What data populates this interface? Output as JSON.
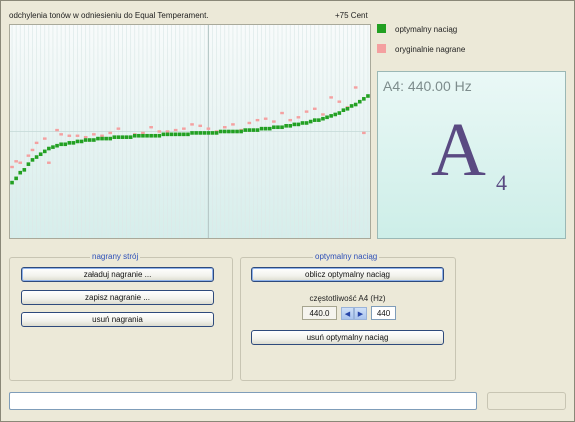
{
  "chart": {
    "title": "odchylenia tonów  w  odniesieniu do Equal Temperament.",
    "range_label": "+75 Cent",
    "legend": [
      {
        "label": "optymalny naciąg",
        "color": "#22a022"
      },
      {
        "label": "oryginalnie nagrane",
        "color": "#f4a0a0"
      }
    ]
  },
  "chart_data": {
    "type": "scatter",
    "title": "odchylenia tonów  w  odniesieniu do Equal Temperament.",
    "xlabel": "",
    "ylabel": "",
    "ylim": [
      -75,
      75
    ],
    "grid": true,
    "series": [
      {
        "name": "optymalny naciąg",
        "color": "#22a022",
        "x": [
          1,
          2,
          3,
          4,
          5,
          6,
          7,
          8,
          9,
          10,
          11,
          12,
          13,
          14,
          15,
          16,
          17,
          18,
          19,
          20,
          21,
          22,
          23,
          24,
          25,
          26,
          27,
          28,
          29,
          30,
          31,
          32,
          33,
          34,
          35,
          36,
          37,
          38,
          39,
          40,
          41,
          42,
          43,
          44,
          45,
          46,
          47,
          48,
          49,
          50,
          51,
          52,
          53,
          54,
          55,
          56,
          57,
          58,
          59,
          60,
          61,
          62,
          63,
          64,
          65,
          66,
          67,
          68,
          69,
          70,
          71,
          72,
          73,
          74,
          75,
          76,
          77,
          78,
          79,
          80,
          81,
          82,
          83,
          84,
          85,
          86,
          87,
          88
        ],
        "y": [
          -36,
          -33,
          -29,
          -27,
          -23,
          -20,
          -18,
          -16,
          -14,
          -12,
          -11,
          -10,
          -9,
          -9,
          -8,
          -8,
          -7,
          -7,
          -6,
          -6,
          -6,
          -5,
          -5,
          -5,
          -5,
          -4,
          -4,
          -4,
          -4,
          -4,
          -3,
          -3,
          -3,
          -3,
          -3,
          -3,
          -3,
          -2,
          -2,
          -2,
          -2,
          -2,
          -2,
          -2,
          -1,
          -1,
          -1,
          -1,
          -1,
          -1,
          -1,
          0,
          0,
          0,
          0,
          0,
          0,
          1,
          1,
          1,
          1,
          2,
          2,
          2,
          3,
          3,
          3,
          4,
          4,
          5,
          5,
          6,
          6,
          7,
          8,
          8,
          9,
          10,
          11,
          12,
          13,
          15,
          16,
          18,
          19,
          21,
          23,
          25
        ]
      },
      {
        "name": "oryginalnie nagrane",
        "color": "#f4a0a0",
        "x": [
          1,
          2,
          3,
          5,
          6,
          7,
          9,
          10,
          12,
          13,
          15,
          17,
          19,
          21,
          23,
          25,
          27,
          29,
          31,
          33,
          35,
          37,
          39,
          41,
          43,
          45,
          47,
          49,
          51,
          53,
          55,
          57,
          59,
          61,
          63,
          65,
          67,
          69,
          71,
          73,
          75,
          77,
          79,
          81,
          83,
          85,
          87
        ],
        "y": [
          -25,
          -21,
          -22,
          -17,
          -13,
          -8,
          -5,
          -22,
          1,
          -2,
          -3,
          -3,
          -4,
          -2,
          -3,
          -1,
          2,
          -4,
          -2,
          -1,
          3,
          0,
          0,
          1,
          2,
          5,
          4,
          2,
          0,
          3,
          5,
          1,
          6,
          8,
          9,
          7,
          13,
          8,
          10,
          14,
          16,
          12,
          24,
          21,
          17,
          31,
          -1
        ]
      }
    ]
  },
  "note_panel": {
    "frequency_text": "A4: 440.00 Hz",
    "note_letter": "A",
    "note_octave": "4"
  },
  "recorded_group": {
    "title": "nagrany strój",
    "load_button": "załaduj nagranie ...",
    "save_button": "zapisz nagranie ...",
    "delete_button": "usuń nagrania"
  },
  "optimal_group": {
    "title": "optymalny naciąg",
    "compute_button": "oblicz optymalny naciąg",
    "freq_label": "częstotliwość A4 (Hz)",
    "freq_value": "440.0",
    "freq_input": "440",
    "delete_button": "usuń optymalny naciąg"
  },
  "status": {
    "input_value": ""
  }
}
